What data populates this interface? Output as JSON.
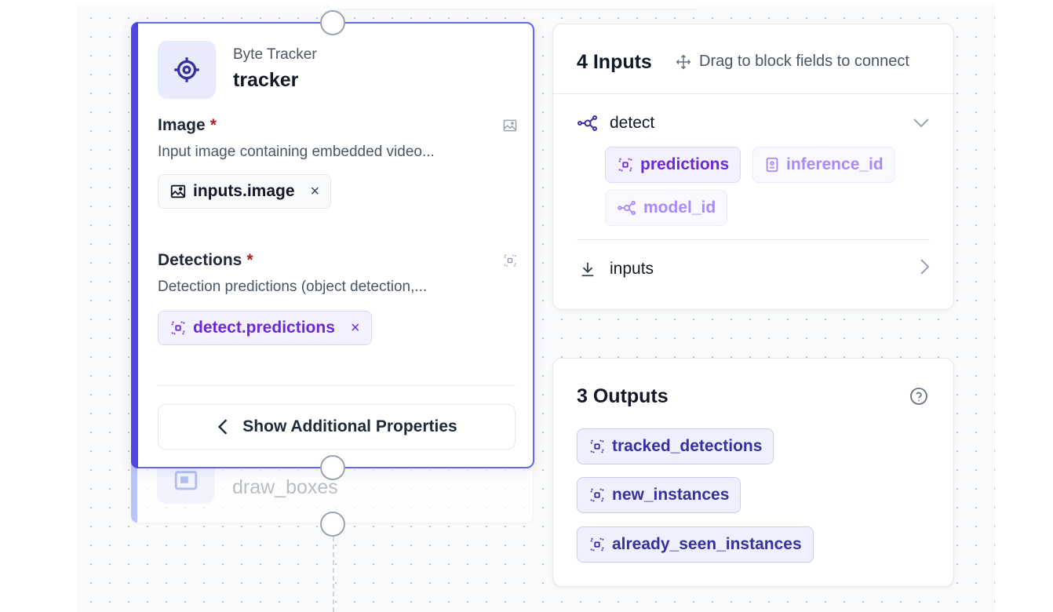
{
  "block": {
    "type_label": "Byte Tracker",
    "name": "tracker",
    "fields": [
      {
        "title": "Image",
        "required_mark": "*",
        "description": "Input image containing embedded video...",
        "value": "inputs.image",
        "remove": "×"
      },
      {
        "title": "Detections",
        "required_mark": "*",
        "description": "Detection predictions (object detection,...",
        "value": "detect.predictions",
        "remove": "×"
      }
    ],
    "show_more_label": "Show Additional Properties"
  },
  "ghost_block": {
    "name": "draw_boxes"
  },
  "inputs_panel": {
    "title": "4 Inputs",
    "drag_hint": "Drag to block fields to connect",
    "sources": [
      {
        "name": "detect",
        "expanded": true,
        "fields": [
          "predictions",
          "inference_id",
          "model_id"
        ]
      },
      {
        "name": "inputs",
        "expanded": false
      }
    ]
  },
  "outputs_panel": {
    "title": "3 Outputs",
    "outputs": [
      "tracked_detections",
      "new_instances",
      "already_seen_instances"
    ]
  },
  "colors": {
    "accent": "#4f46e5",
    "selection_border": "#6366f1",
    "required": "#b91c1c",
    "chip_purple": "#6d28d9"
  }
}
